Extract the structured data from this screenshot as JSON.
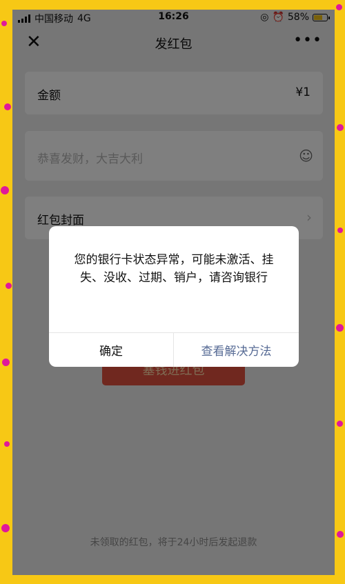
{
  "status_bar": {
    "carrier": "中国移动",
    "network": "4G",
    "time": "16:26",
    "battery_percent": "58%",
    "battery_level": 0.58
  },
  "navbar": {
    "title": "发红包",
    "close_glyph": "✕",
    "more_glyph": "•••"
  },
  "form": {
    "amount_label": "金额",
    "amount_value": "¥1",
    "greeting_placeholder": "恭喜发财，大吉大利",
    "cover_label": "红包封面"
  },
  "send_button_label": "塞钱进红包",
  "footnote": "未领取的红包，将于24小时后发起退款",
  "dialog": {
    "message": "您的银行卡状态异常，可能未激活、挂失、没收、过期、销户，请咨询银行",
    "confirm_label": "确定",
    "solution_label": "查看解决方法"
  },
  "colors": {
    "frame_background": "#f7c815",
    "accent_red": "#e0513e",
    "link_blue": "#576b95"
  },
  "icons": [
    "close-icon",
    "more-icon",
    "emoji-icon",
    "chevron-right-icon",
    "alarm-icon",
    "battery-icon",
    "signal-icon"
  ]
}
